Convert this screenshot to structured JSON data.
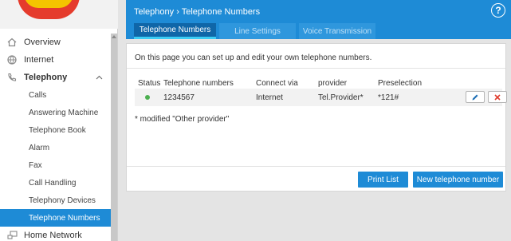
{
  "header": {
    "breadcrumb": "Telephony › Telephone Numbers",
    "help_glyph": "?"
  },
  "tabs": [
    {
      "label": "Telephone Numbers",
      "active": true
    },
    {
      "label": "Line Settings",
      "active": false
    },
    {
      "label": "Voice Transmission",
      "active": false
    }
  ],
  "sidebar": {
    "top_items": [
      {
        "label": "Overview",
        "icon": "home-icon"
      },
      {
        "label": "Internet",
        "icon": "globe-icon"
      }
    ],
    "expanded": {
      "label": "Telephony",
      "icon": "phone-icon",
      "chevron": "^"
    },
    "sub_items": [
      {
        "label": "Calls"
      },
      {
        "label": "Answering Machine"
      },
      {
        "label": "Telephone Book"
      },
      {
        "label": "Alarm"
      },
      {
        "label": "Fax"
      },
      {
        "label": "Call Handling"
      },
      {
        "label": "Telephony Devices"
      },
      {
        "label": "Telephone Numbers",
        "active": true
      }
    ],
    "after_item": {
      "label": "Home Network",
      "icon": "network-icon"
    }
  },
  "main": {
    "intro": "On this page you can set up and edit your own telephone numbers.",
    "columns": [
      "Status",
      "Telephone numbers",
      "Connect via",
      "provider",
      "Preselection"
    ],
    "rows": [
      {
        "status": "active",
        "number": "1234567",
        "connect_via": "Internet",
        "provider": "Tel.Provider*",
        "preselection": "*121#"
      }
    ],
    "footnote": "* modified \"Other provider\"",
    "print_button": "Print List",
    "new_button": "New telephone number"
  },
  "colors": {
    "accent": "#1e8bd6",
    "tab_active": "#0f66a8",
    "status_ok": "#4caf50",
    "delete": "#e03b2c"
  }
}
